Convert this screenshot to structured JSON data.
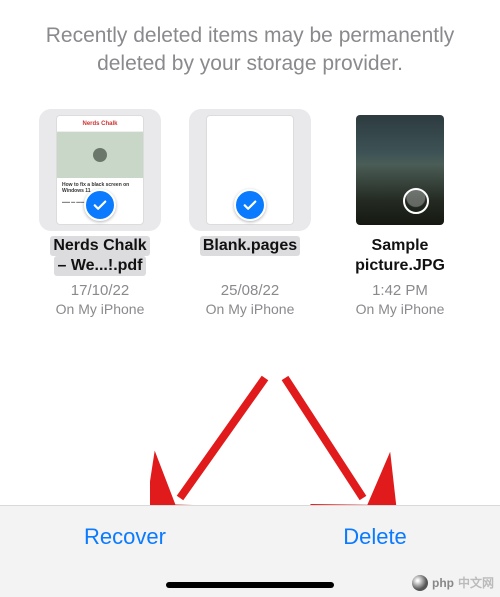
{
  "header": {
    "info": "Recently deleted items may be permanently deleted by your storage provider."
  },
  "files": [
    {
      "name_line1": "Nerds Chalk",
      "name_line2": "– We...!.pdf",
      "date": "17/10/22",
      "location": "On My iPhone",
      "selected": true,
      "kind": "pdf"
    },
    {
      "name_line1": "Blank.pages",
      "name_line2": "",
      "date": "25/08/22",
      "location": "On My iPhone",
      "selected": true,
      "kind": "pages"
    },
    {
      "name_line1": "Sample",
      "name_line2": "picture.JPG",
      "date": "1:42 PM",
      "location": "On My iPhone",
      "selected": false,
      "kind": "photo"
    }
  ],
  "toolbar": {
    "recover": "Recover",
    "delete": "Delete"
  },
  "watermark": "中文网",
  "annotation": {
    "arrow_color": "#e11b1b"
  }
}
